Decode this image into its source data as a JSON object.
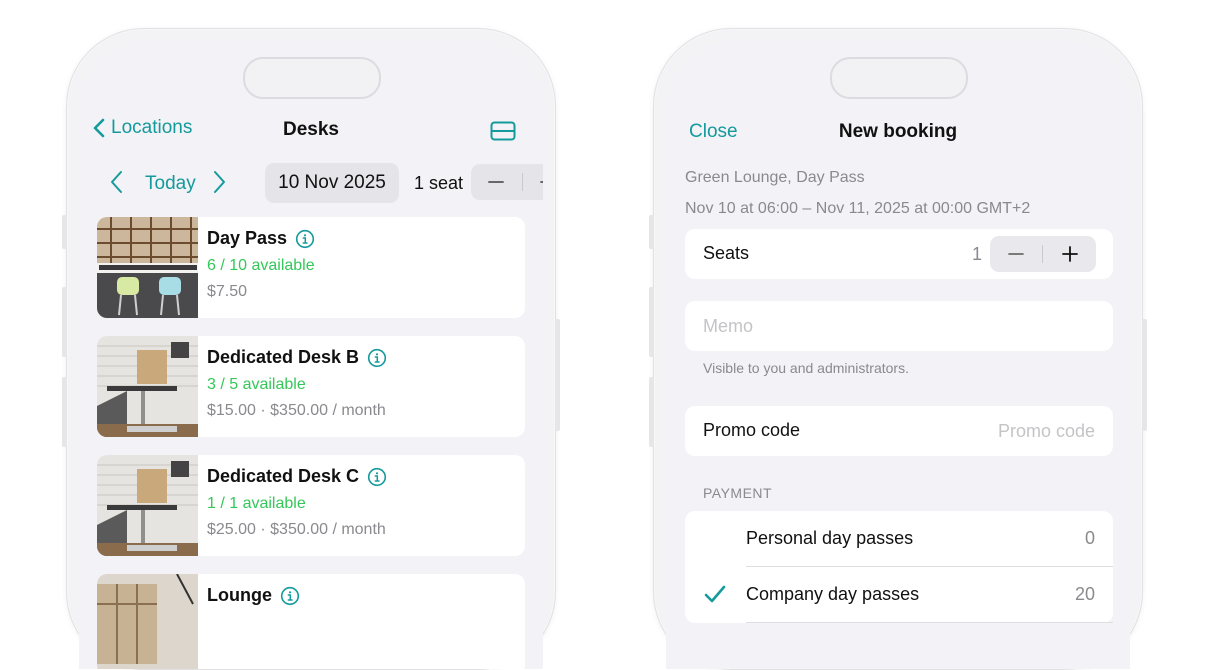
{
  "colors": {
    "accent": "#159a9c",
    "available": "#34c759",
    "secondary": "#8a8a8e"
  },
  "left": {
    "nav": {
      "back_label": "Locations",
      "title": "Desks",
      "layout_icon": "layout-rows-icon"
    },
    "date_bar": {
      "today_label": "Today",
      "date": "10 Nov 2025",
      "seat_label": "1 seat"
    },
    "items": [
      {
        "title": "Day Pass",
        "availability": "6 / 10 available",
        "price": "$7.50"
      },
      {
        "title": "Dedicated Desk B",
        "availability": "3 / 5 available",
        "price": "$15.00 · $350.00 / month"
      },
      {
        "title": "Dedicated Desk C",
        "availability": "1 / 1 available",
        "price": "$25.00 · $350.00 / month"
      },
      {
        "title": "Lounge",
        "availability": "",
        "price": ""
      }
    ]
  },
  "right": {
    "nav": {
      "close_label": "Close",
      "title": "New booking"
    },
    "summary": {
      "line1": "Green Lounge, Day Pass",
      "line2": "Nov 10 at 06:00 – Nov 11, 2025 at 00:00 GMT+2"
    },
    "seats": {
      "label": "Seats",
      "value": "1"
    },
    "memo": {
      "placeholder": "Memo",
      "hint": "Visible to you and administrators."
    },
    "promo": {
      "label": "Promo code",
      "placeholder": "Promo code"
    },
    "payment": {
      "header": "PAYMENT",
      "options": [
        {
          "label": "Personal day passes",
          "value": "0",
          "selected": false
        },
        {
          "label": "Company day passes",
          "value": "20",
          "selected": true
        }
      ]
    }
  }
}
